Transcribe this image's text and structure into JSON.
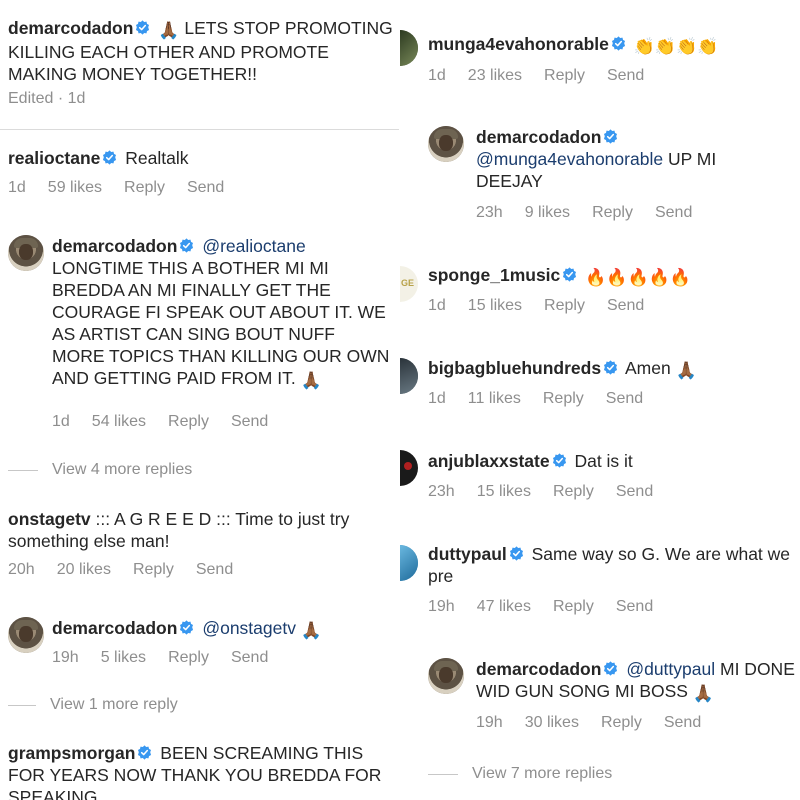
{
  "left": {
    "post": {
      "username": "demarcodadon",
      "emoji": "🙏🏾",
      "text": " LETS STOP PROMOTING KILLING EACH OTHER AND PROMOTE MAKING MONEY TOGETHER!!",
      "edited": "Edited · 1d"
    },
    "c1": {
      "username": "realioctane",
      "text": "Realtalk",
      "time": "1d",
      "likes": "59 likes",
      "reply": "Reply",
      "send": "Send"
    },
    "r1": {
      "username": "demarcodadon",
      "mention": "@realioctane",
      "text": "LONGTIME THIS A BOTHER MI MI BREDDA AN MI FINALLY GET THE COURAGE FI SPEAK OUT ABOUT IT. WE AS ARTIST CAN SING BOUT NUFF MORE TOPICS THAN KILLING OUR OWN AND GETTING PAID FROM IT.",
      "emoji": "🙏🏾",
      "time": "1d",
      "likes": "54 likes",
      "reply": "Reply",
      "send": "Send"
    },
    "view1": "View 4 more replies",
    "c2": {
      "username": "onstagetv",
      "text": "::: A G R E E D ::: Time to just try something else man!",
      "time": "20h",
      "likes": "20 likes",
      "reply": "Reply",
      "send": "Send"
    },
    "r2": {
      "username": "demarcodadon",
      "mention": "@onstagetv",
      "emoji": "🙏🏾",
      "time": "19h",
      "likes": "5 likes",
      "reply": "Reply",
      "send": "Send"
    },
    "view2": "View 1 more reply",
    "c3": {
      "username": "grampsmorgan",
      "text": "BEEN SCREAMING THIS FOR YEARS NOW THANK YOU BREDDA FOR SPEAKING"
    }
  },
  "right": {
    "c1": {
      "username": "munga4evahonorable",
      "emoji": "👏👏👏👏",
      "time": "1d",
      "likes": "23 likes",
      "reply": "Reply",
      "send": "Send"
    },
    "r1": {
      "username": "demarcodadon",
      "mention": "@munga4evahonorable",
      "text": "UP MI DEEJAY",
      "time": "23h",
      "likes": "9 likes",
      "reply": "Reply",
      "send": "Send"
    },
    "c2": {
      "username": "sponge_1music",
      "emoji": "🔥🔥🔥🔥🔥",
      "time": "1d",
      "likes": "15 likes",
      "reply": "Reply",
      "send": "Send"
    },
    "c3": {
      "username": "bigbagbluehundreds",
      "text": "Amen",
      "emoji": "🙏🏾",
      "time": "1d",
      "likes": "11 likes",
      "reply": "Reply",
      "send": "Send"
    },
    "c4": {
      "username": "anjublaxxstate",
      "text": "Dat is it",
      "time": "23h",
      "likes": "15 likes",
      "reply": "Reply",
      "send": "Send"
    },
    "c5": {
      "username": "duttypaul",
      "text": "Same way so G. We are what we pre",
      "time": "19h",
      "likes": "47 likes",
      "reply": "Reply",
      "send": "Send"
    },
    "r2": {
      "username": "demarcodadon",
      "mention": "@duttypaul",
      "text": "MI DONE WID GUN SONG MI BOSS",
      "emoji": "🙏🏾",
      "time": "19h",
      "likes": "30 likes",
      "reply": "Reply",
      "send": "Send"
    },
    "view1": "View 7 more replies"
  },
  "colors": {
    "verified": "#3897f0",
    "mention": "#1b3d6e",
    "meta": "#8e8e8e",
    "text": "#262626"
  }
}
